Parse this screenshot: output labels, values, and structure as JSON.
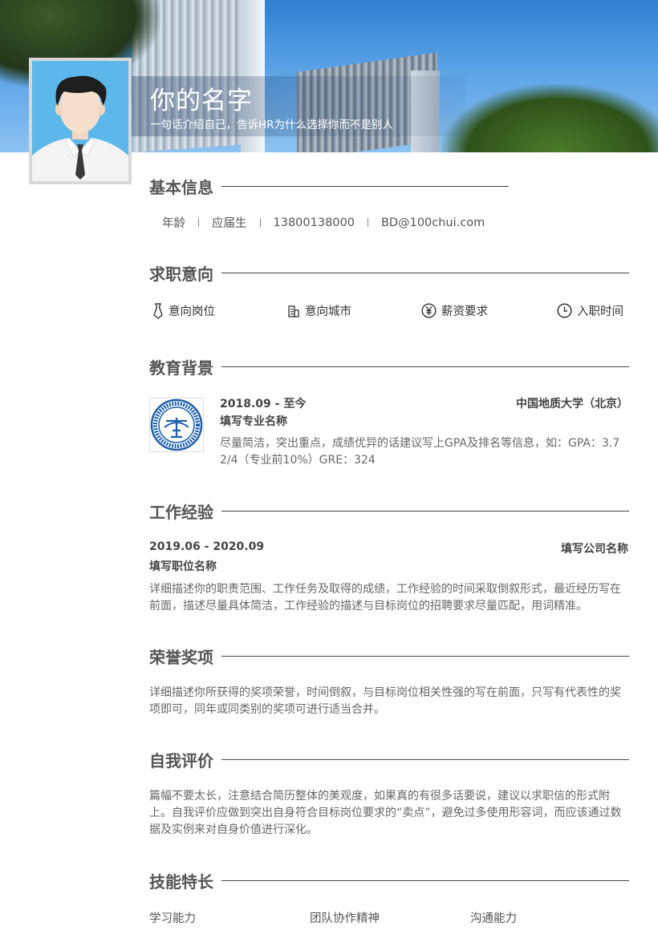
{
  "header": {
    "name": "你的名字",
    "tagline": "一句话介绍自己，告诉HR为什么选择你而不是别人"
  },
  "sections": {
    "basic": {
      "title": "基本信息",
      "items": [
        "年龄",
        "应届生",
        "13800138000",
        "BD@100chui.com"
      ]
    },
    "intent": {
      "title": "求职意向",
      "items": [
        {
          "icon": "tie-icon",
          "label": "意向岗位"
        },
        {
          "icon": "building-icon",
          "label": "意向城市"
        },
        {
          "icon": "yen-icon",
          "label": "薪资要求"
        },
        {
          "icon": "clock-icon",
          "label": "入职时间"
        }
      ]
    },
    "education": {
      "title": "教育背景",
      "date": "2018.09 - 至今",
      "school": "中国地质大学（北京）",
      "major": "填写专业名称",
      "desc": "尽量简洁，突出重点，成绩优异的话建议写上GPA及排名等信息，如：GPA：3.72/4（专业前10%）GRE：324",
      "logo_icon": "university-seal-icon"
    },
    "work": {
      "title": "工作经验",
      "date": "2019.06 - 2020.09",
      "company": "填写公司名称",
      "position": "填写职位名称",
      "desc": "详细描述你的职责范围、工作任务及取得的成绩，工作经验的时间采取倒叙形式，最近经历写在前面，描述尽量具体简洁，工作经验的描述与目标岗位的招聘要求尽量匹配，用词精准。"
    },
    "honors": {
      "title": "荣誉奖项",
      "desc": "详细描述你所获得的奖项荣誉，时间倒叙，与目标岗位相关性强的写在前面，只写有代表性的奖项即可，同年或同类别的奖项可进行适当合并。"
    },
    "self": {
      "title": "自我评价",
      "desc": "篇幅不要太长，注意结合简历整体的美观度，如果真的有很多话要说，建议以求职信的形式附上。自我评价应做到突出自身符合目标岗位要求的“卖点”，避免过多使用形容词，而应该通过数据及实例来对自身价值进行深化。"
    },
    "skills": {
      "title": "技能特长",
      "items": [
        "学习能力",
        "团队协作精神",
        "沟通能力"
      ]
    }
  },
  "colors": {
    "avatar_bg": "#5cb8ea",
    "title_text": "#555555",
    "rule": "#444444"
  }
}
